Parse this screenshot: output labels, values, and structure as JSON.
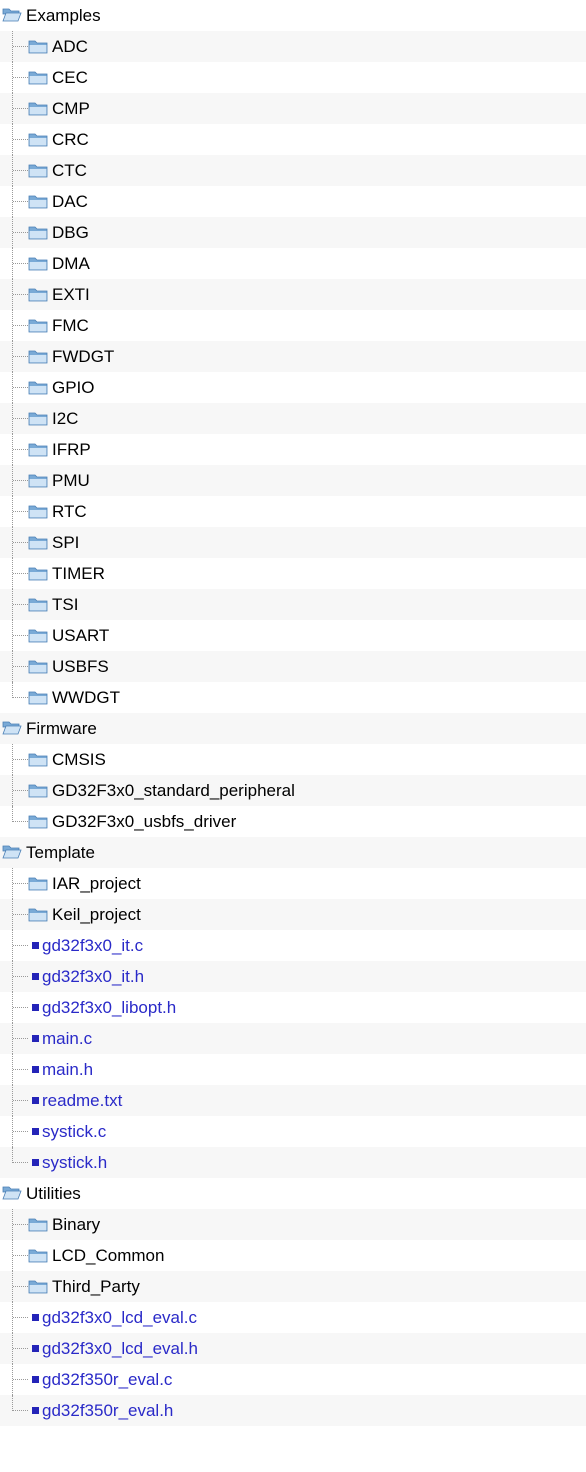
{
  "colors": {
    "folder": "#7aaad6",
    "folder_light": "#cfe3f5",
    "file_link": "#2a2ac8",
    "file_bullet": "#2424b8",
    "band": "#f7f7f7"
  },
  "tree": [
    {
      "label": "Examples",
      "type": "folder-open",
      "children": [
        {
          "label": "ADC",
          "type": "folder"
        },
        {
          "label": "CEC",
          "type": "folder"
        },
        {
          "label": "CMP",
          "type": "folder"
        },
        {
          "label": "CRC",
          "type": "folder"
        },
        {
          "label": "CTC",
          "type": "folder"
        },
        {
          "label": "DAC",
          "type": "folder"
        },
        {
          "label": "DBG",
          "type": "folder"
        },
        {
          "label": "DMA",
          "type": "folder"
        },
        {
          "label": "EXTI",
          "type": "folder"
        },
        {
          "label": "FMC",
          "type": "folder"
        },
        {
          "label": "FWDGT",
          "type": "folder"
        },
        {
          "label": "GPIO",
          "type": "folder"
        },
        {
          "label": "I2C",
          "type": "folder"
        },
        {
          "label": "IFRP",
          "type": "folder"
        },
        {
          "label": "PMU",
          "type": "folder"
        },
        {
          "label": "RTC",
          "type": "folder"
        },
        {
          "label": "SPI",
          "type": "folder"
        },
        {
          "label": "TIMER",
          "type": "folder"
        },
        {
          "label": "TSI",
          "type": "folder"
        },
        {
          "label": "USART",
          "type": "folder"
        },
        {
          "label": "USBFS",
          "type": "folder"
        },
        {
          "label": "WWDGT",
          "type": "folder"
        }
      ]
    },
    {
      "label": "Firmware",
      "type": "folder-open",
      "children": [
        {
          "label": "CMSIS",
          "type": "folder"
        },
        {
          "label": "GD32F3x0_standard_peripheral",
          "type": "folder"
        },
        {
          "label": "GD32F3x0_usbfs_driver",
          "type": "folder"
        }
      ]
    },
    {
      "label": "Template",
      "type": "folder-open",
      "children": [
        {
          "label": "IAR_project",
          "type": "folder"
        },
        {
          "label": "Keil_project",
          "type": "folder"
        },
        {
          "label": "gd32f3x0_it.c",
          "type": "file"
        },
        {
          "label": "gd32f3x0_it.h",
          "type": "file"
        },
        {
          "label": "gd32f3x0_libopt.h",
          "type": "file"
        },
        {
          "label": "main.c",
          "type": "file"
        },
        {
          "label": "main.h",
          "type": "file"
        },
        {
          "label": "readme.txt",
          "type": "file"
        },
        {
          "label": "systick.c",
          "type": "file"
        },
        {
          "label": "systick.h",
          "type": "file"
        }
      ]
    },
    {
      "label": "Utilities",
      "type": "folder-open",
      "children": [
        {
          "label": "Binary",
          "type": "folder"
        },
        {
          "label": "LCD_Common",
          "type": "folder"
        },
        {
          "label": "Third_Party",
          "type": "folder"
        },
        {
          "label": "gd32f3x0_lcd_eval.c",
          "type": "file"
        },
        {
          "label": "gd32f3x0_lcd_eval.h",
          "type": "file"
        },
        {
          "label": "gd32f350r_eval.c",
          "type": "file"
        },
        {
          "label": "gd32f350r_eval.h",
          "type": "file"
        }
      ]
    }
  ]
}
